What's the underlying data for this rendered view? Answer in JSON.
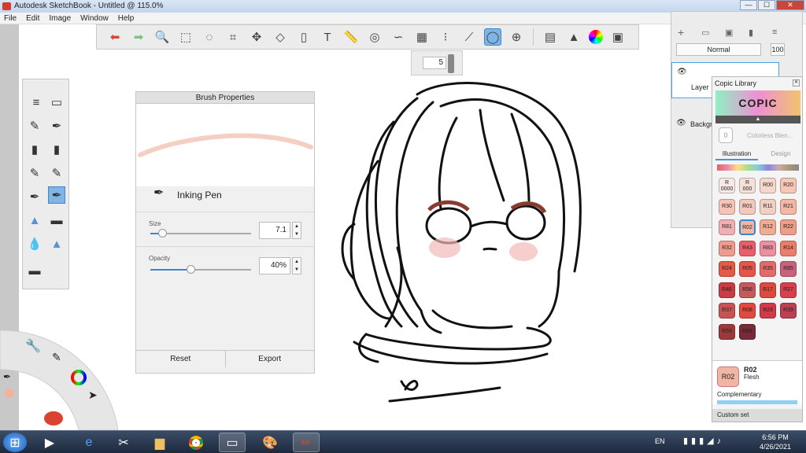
{
  "window": {
    "title": "Autodesk SketchBook - Untitled @ 115.0%",
    "min": "—",
    "max": "☐",
    "close": "✕"
  },
  "menu": [
    "File",
    "Edit",
    "Image",
    "Window",
    "Help"
  ],
  "toolbar": {
    "icons": [
      "undo-icon",
      "redo-icon",
      "zoom-icon",
      "select-icon",
      "lasso-select-icon",
      "crop-icon",
      "transform-icon",
      "distort-icon",
      "fill-icon",
      "text-icon",
      "ruler-icon",
      "ellipse-guide-icon",
      "french-curve-icon",
      "perspective-icon",
      "symmetry-icon",
      "stroke-icon",
      "predictive-stroke-icon",
      "shapes-icon",
      "copic-icon",
      "brushes-icon",
      "color-wheel-icon",
      "palette-icon"
    ],
    "active": "predictive-stroke-icon"
  },
  "brush_size_popup": {
    "value": "5"
  },
  "brush_properties": {
    "title": "Brush Properties",
    "brush_name": "Inking Pen",
    "size_label": "Size",
    "size_value": "7.1",
    "size_fraction": 0.12,
    "opacity_label": "Opacity",
    "opacity_value": "40%",
    "opacity_fraction": 0.4,
    "reset_label": "Reset",
    "export_label": "Export"
  },
  "layers": {
    "blend_mode": "Normal",
    "opacity": "100",
    "items": [
      "Layer",
      "Background"
    ]
  },
  "copic": {
    "title": "Copic Library",
    "logo": "COPIC",
    "colorless": "Colorless Blen...",
    "colorless_code": "0",
    "tabs": [
      "Illustration",
      "Design"
    ],
    "active_tab": "Illustration",
    "swatches": [
      {
        "code": "R\n0000",
        "color": "#f7e9e4"
      },
      {
        "code": "R\n000",
        "color": "#f5e1da"
      },
      {
        "code": "R00",
        "color": "#f6d7cb"
      },
      {
        "code": "R20",
        "color": "#f7c7b5"
      },
      {
        "code": "R30",
        "color": "#f6c4b7"
      },
      {
        "code": "R01",
        "color": "#f3c9bd"
      },
      {
        "code": "R11",
        "color": "#f2cfc3"
      },
      {
        "code": "R21",
        "color": "#f3b7a4"
      },
      {
        "code": "R81",
        "color": "#f0b0b3"
      },
      {
        "code": "R02",
        "color": "#f0b5a3"
      },
      {
        "code": "R12",
        "color": "#f0ad94"
      },
      {
        "code": "R22",
        "color": "#ee9d87"
      },
      {
        "code": "R32",
        "color": "#ef9c8f"
      },
      {
        "code": "R43",
        "color": "#e85e6a"
      },
      {
        "code": "R83",
        "color": "#ec8fa0"
      },
      {
        "code": "R14",
        "color": "#ec7c6b"
      },
      {
        "code": "R24",
        "color": "#e35a47"
      },
      {
        "code": "R05",
        "color": "#e5554a"
      },
      {
        "code": "R35",
        "color": "#e46b6b"
      },
      {
        "code": "R85",
        "color": "#c9607c"
      },
      {
        "code": "R46",
        "color": "#c73d43"
      },
      {
        "code": "R56",
        "color": "#c35a5c"
      },
      {
        "code": "R17",
        "color": "#de4b3d"
      },
      {
        "code": "R27",
        "color": "#d8404c"
      },
      {
        "code": "R37",
        "color": "#c65454"
      },
      {
        "code": "R08",
        "color": "#e24a3f"
      },
      {
        "code": "R29",
        "color": "#d13a47"
      },
      {
        "code": "R39",
        "color": "#b94152"
      },
      {
        "code": "R59",
        "color": "#9c3a3a"
      },
      {
        "code": "R89",
        "color": "#7a2a36"
      }
    ],
    "selected_code": "R02",
    "selected_name": "Flesh",
    "complementary_label": "Complementary",
    "custom_set_label": "Custom set"
  },
  "taskbar": {
    "apps": [
      "start-icon",
      "media-player-icon",
      "internet-explorer-icon",
      "snipping-tool-icon",
      "file-explorer-icon",
      "chrome-icon",
      "photo-viewer-icon",
      "paint-icon",
      "sketchbook-icon"
    ],
    "language": "EN",
    "time": "6:56 PM",
    "date": "4/26/2021"
  }
}
